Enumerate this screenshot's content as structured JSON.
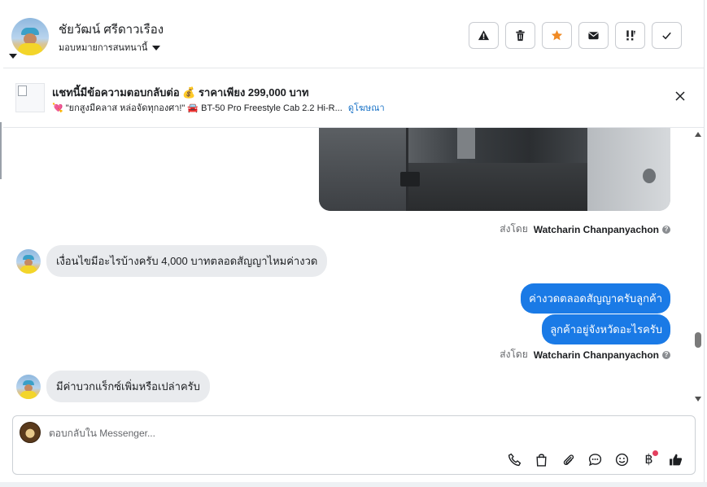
{
  "header": {
    "contact_name": "ชัยวัฒน์ ศรีดาวเรือง",
    "assign_label": "มอบหมายการสนทนานี้",
    "actions": [
      {
        "icon": "warning-icon"
      },
      {
        "icon": "trash-icon"
      },
      {
        "icon": "star-icon",
        "color": "#f08a24"
      },
      {
        "icon": "envelope-icon"
      },
      {
        "icon": "exclamation-icon"
      },
      {
        "icon": "check-icon"
      }
    ]
  },
  "ad_banner": {
    "title": "แชทนี้มีข้อความตอบกลับต่อ 💰 ราคาเพียง 299,000 บาท",
    "subtitle": "💘 \"ยกสูงมีคลาส หล่อจัดทุกองศา!\" 🚘 BT-50 Pro Freestyle Cab 2.2 Hi-R...",
    "link_label": "ดูโฆษณา"
  },
  "messages": {
    "sent_by_prefix": "ส่งโดย",
    "agent_name": "Watcharin Chanpanyachon",
    "incoming_1": "เงื่อนไขมีอะไรบ้างครับ 4,000 บาทตลอดสัญญาไหมค่างวด",
    "outgoing_1": "ค่างวดตลอดสัญญาครับลูกค้า",
    "outgoing_2": "ลูกค้าอยู่จังหวัดอะไรครับ",
    "incoming_2": "มีค่าบวกแร็กซ์เพิ่มหรือเปล่าครับ"
  },
  "composer": {
    "placeholder": "ตอบกลับใน Messenger...",
    "baht_symbol": "฿",
    "tools": [
      "phone-icon",
      "shopping-bag-icon",
      "paperclip-icon",
      "chat-bubble-icon",
      "smiley-icon",
      "baht-icon",
      "thumbs-up-icon"
    ]
  },
  "colors": {
    "accent_blue": "#1a7ae6",
    "incoming_bubble": "#e9ebee",
    "star": "#f08a24",
    "notification_dot": "#e4405f"
  }
}
